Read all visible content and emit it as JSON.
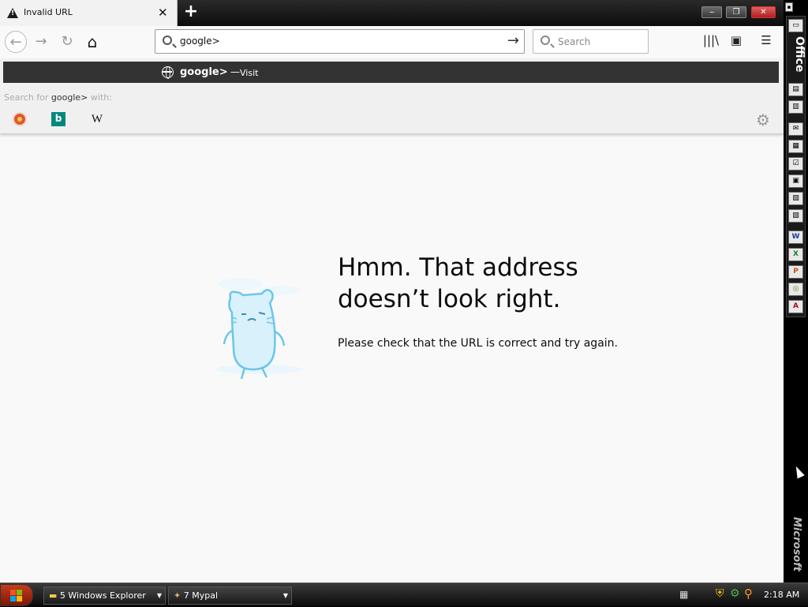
{
  "tab": {
    "title": "Invalid URL",
    "close_glyph": "✕",
    "warning_icon": "warning-icon"
  },
  "newtab": {
    "glyph": "+"
  },
  "window_controls": {
    "minimize": "‒",
    "restore": "❐",
    "close": "✕"
  },
  "navbar": {
    "back_glyph": "←",
    "forward_glyph": "→",
    "reload_glyph": "↻",
    "home_glyph": "⌂",
    "url_value": "google>",
    "go_glyph": "→",
    "search_placeholder": "Search",
    "library_glyph": "|||\\",
    "sidebar_glyph": "▣",
    "menu_glyph": "☰"
  },
  "dropdown": {
    "suggestion_text": "google>",
    "suggestion_dash": "—",
    "suggestion_action": "Visit",
    "search_for_prefix": "Search for ",
    "search_for_term": "google>",
    "search_for_suffix": " with:",
    "engines": [
      "duckduckgo-icon",
      "bing-icon",
      "wikipedia-icon"
    ],
    "bing_letter": "b",
    "wiki_letter": "W",
    "settings_glyph": "⚙"
  },
  "error": {
    "title": "Hmm. That address doesn’t look right.",
    "message": "Please check that the URL is correct and try again."
  },
  "officebar": {
    "title": "Office",
    "brand": "Microsoft"
  },
  "taskbar": {
    "tasks": [
      {
        "label": "5 Windows Explorer"
      },
      {
        "label": "7 Mypal"
      }
    ],
    "clock": "2:18 AM"
  },
  "colors": {
    "suggest_bg": "#333333",
    "page_bg": "#f9f9fa",
    "mascot": "#7fd3ef"
  }
}
